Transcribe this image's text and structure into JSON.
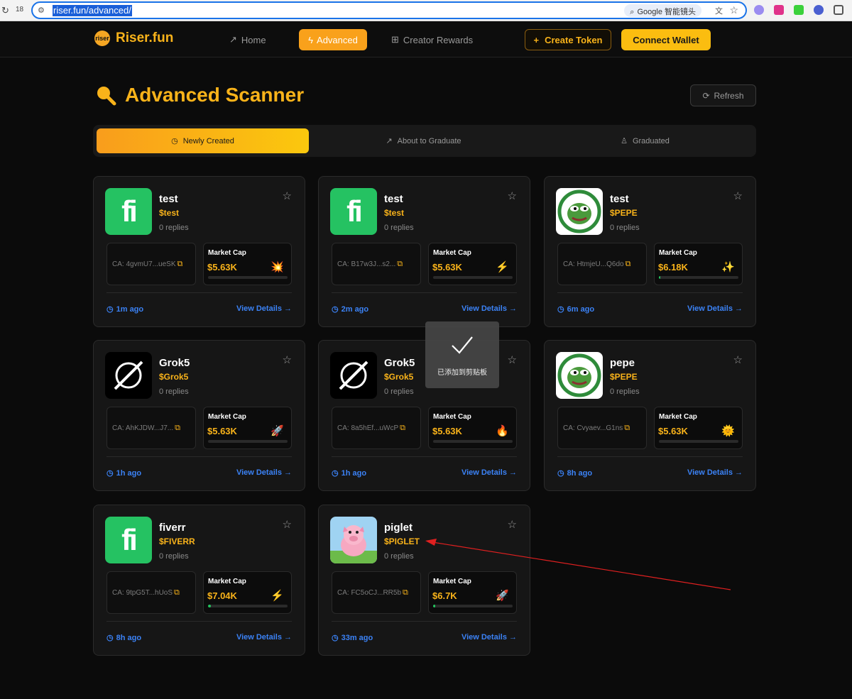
{
  "browser": {
    "tab_count": "18",
    "url": "riser.fun/advanced/",
    "lens_label": "Google 智能镜头"
  },
  "nav": {
    "logo_text": "Riser.fun",
    "logo_mark": "riser",
    "home": "Home",
    "advanced": "Advanced",
    "creator_rewards": "Creator Rewards",
    "create_token": "Create Token",
    "connect_wallet": "Connect Wallet"
  },
  "header": {
    "title": "Advanced Scanner",
    "refresh": "Refresh"
  },
  "tabs": {
    "newly_created": "Newly Created",
    "about_to_graduate": "About to Graduate",
    "graduated": "Graduated"
  },
  "common": {
    "market_cap_label": "Market Cap",
    "view_details": "View Details →"
  },
  "tokens": [
    {
      "name": "test",
      "symbol": "$test",
      "replies": "0 replies",
      "ca": "CA: 4gvmU7...ueSK",
      "market_cap": "$5.63K",
      "emoji": "💥",
      "progress": 0,
      "age": "1m ago",
      "avatar": "fiverr-logo"
    },
    {
      "name": "test",
      "symbol": "$test",
      "replies": "0 replies",
      "ca": "CA: B17w3J...s2...",
      "market_cap": "$5.63K",
      "emoji": "⚡",
      "progress": 0,
      "age": "2m ago",
      "avatar": "fiverr-logo"
    },
    {
      "name": "test",
      "symbol": "$PEPE",
      "replies": "0 replies",
      "ca": "CA: HtmjeU...Q6do",
      "market_cap": "$6.18K",
      "emoji": "✨",
      "progress": 0.02,
      "age": "6m ago",
      "avatar": "pepe-frog"
    },
    {
      "name": "Grok5",
      "symbol": "$Grok5",
      "replies": "0 replies",
      "ca": "CA: AhKJDW...J7...",
      "market_cap": "$5.63K",
      "emoji": "🚀",
      "progress": 0,
      "age": "1h ago",
      "avatar": "grok-logo"
    },
    {
      "name": "Grok5",
      "symbol": "$Grok5",
      "replies": "0 replies",
      "ca": "CA: 8a5hEf...uWcP",
      "market_cap": "$5.63K",
      "emoji": "🔥",
      "progress": 0,
      "age": "1h ago",
      "avatar": "grok-logo"
    },
    {
      "name": "pepe",
      "symbol": "$PEPE",
      "replies": "0 replies",
      "ca": "CA: Cvyaev...G1ns",
      "market_cap": "$5.63K",
      "emoji": "🌞",
      "progress": 0,
      "age": "8h ago",
      "avatar": "pepe-frog"
    },
    {
      "name": "fiverr",
      "symbol": "$FIVERR",
      "replies": "0 replies",
      "ca": "CA: 9tpG5T...hUoS",
      "market_cap": "$7.04K",
      "emoji": "⚡",
      "progress": 0.04,
      "age": "8h ago",
      "avatar": "fiverr-logo"
    },
    {
      "name": "piglet",
      "symbol": "$PIGLET",
      "replies": "0 replies",
      "ca": "CA: FC5oCJ...RR5b",
      "market_cap": "$6.7K",
      "emoji": "🚀",
      "progress": 0.03,
      "age": "33m ago",
      "avatar": "piglet-image"
    }
  ],
  "toast": {
    "message": "已添加到剪贴板"
  },
  "colors": {
    "accent": "#f9b31a",
    "link": "#3b82f6",
    "card_bg": "#161616",
    "annotation": "#e02020"
  }
}
